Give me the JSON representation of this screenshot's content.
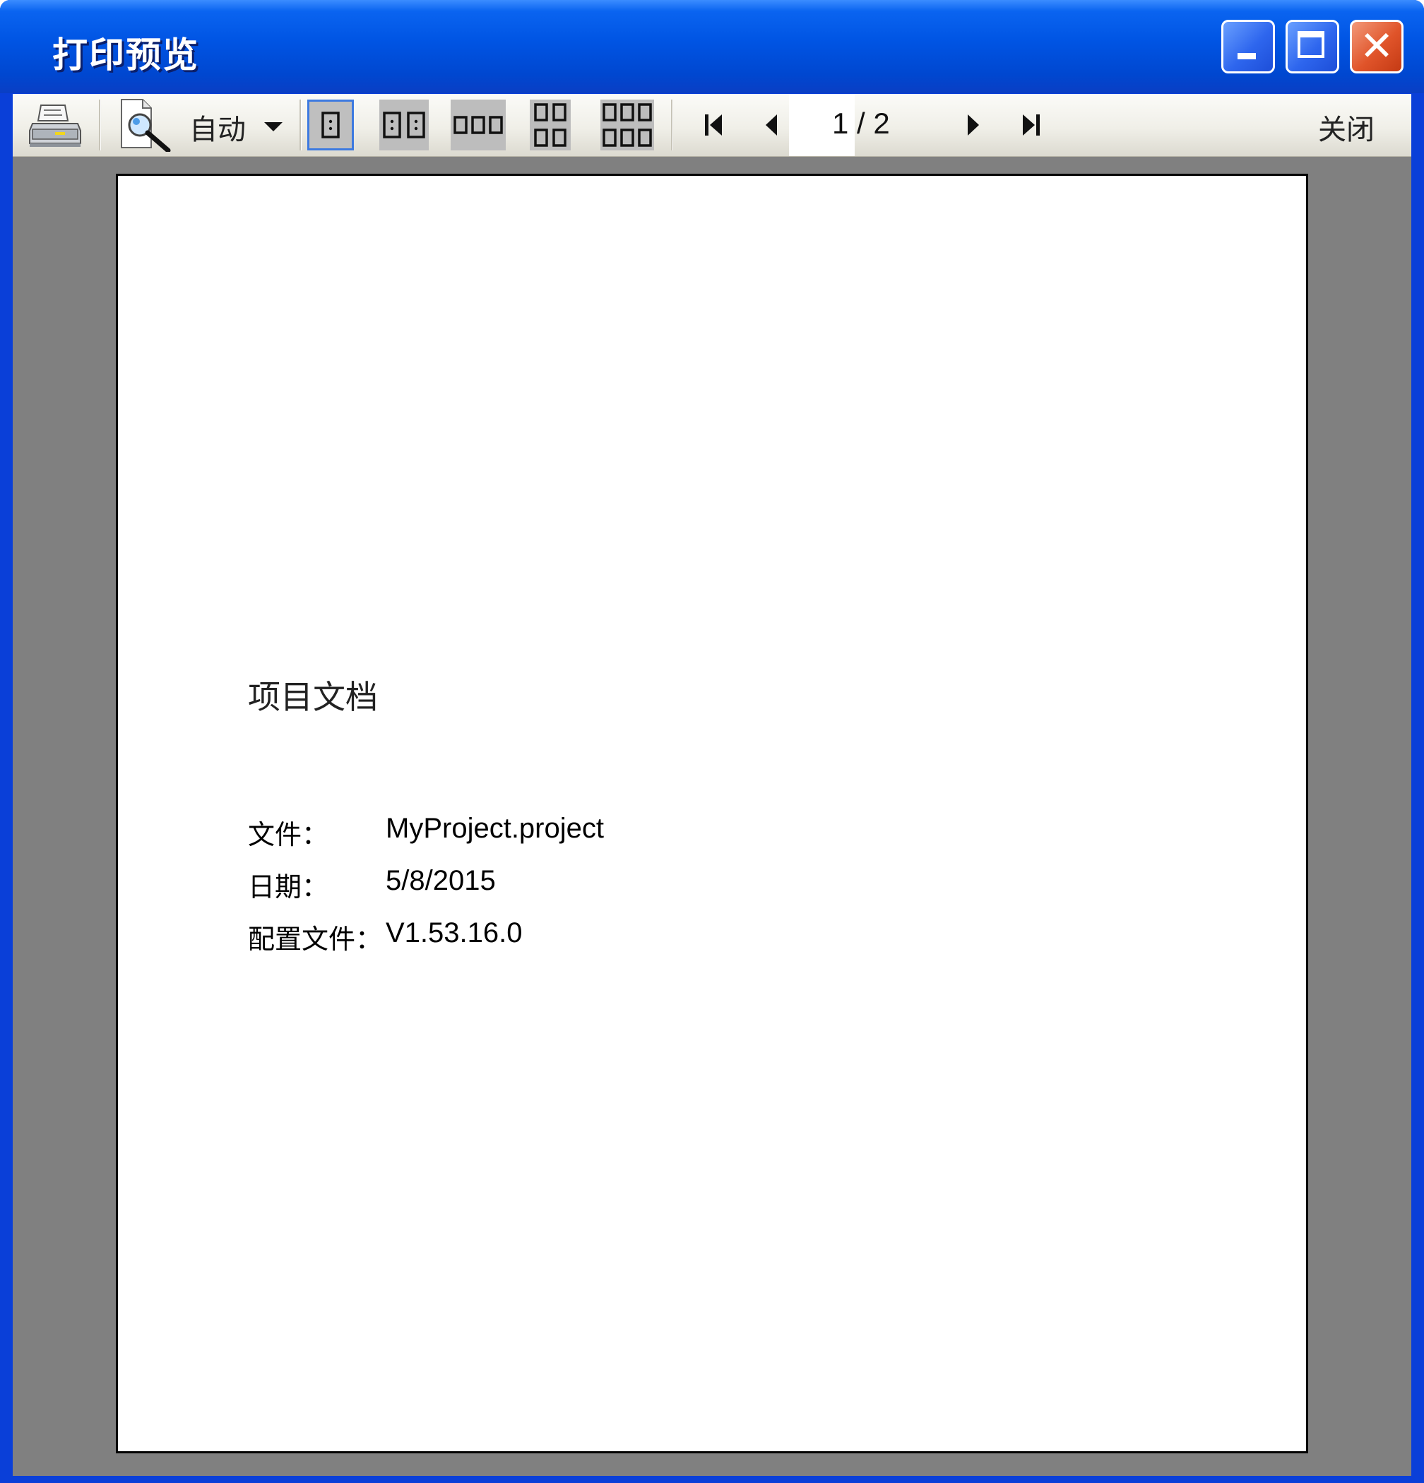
{
  "window": {
    "title": "打印预览",
    "controls": {
      "minimize": "minimize",
      "maximize": "maximize",
      "close_glyph": "✕"
    }
  },
  "toolbar": {
    "print_icon": "printer-icon",
    "zoom_icon": "magnifier-page-icon",
    "zoom_label": "自动",
    "layouts": [
      "one-page",
      "two-pages",
      "three-pages",
      "four-pages",
      "six-pages"
    ],
    "active_layout": "one-page",
    "navigation": [
      "first-page",
      "previous-page",
      "next-page",
      "last-page"
    ],
    "page_indicator": "1 / 2",
    "close_label": "关闭"
  },
  "document": {
    "title": "项目文档",
    "fields": [
      {
        "label": "文件：",
        "value": "MyProject.project"
      },
      {
        "label": "日期：",
        "value": "5/8/2015"
      },
      {
        "label": "配置文件：",
        "value": "V1.53.16.0"
      }
    ]
  },
  "colors": {
    "titlebar": "#0054e3",
    "preview_background": "#808080",
    "active_border": "#3d7ae0",
    "close_button": "#e0542a"
  }
}
